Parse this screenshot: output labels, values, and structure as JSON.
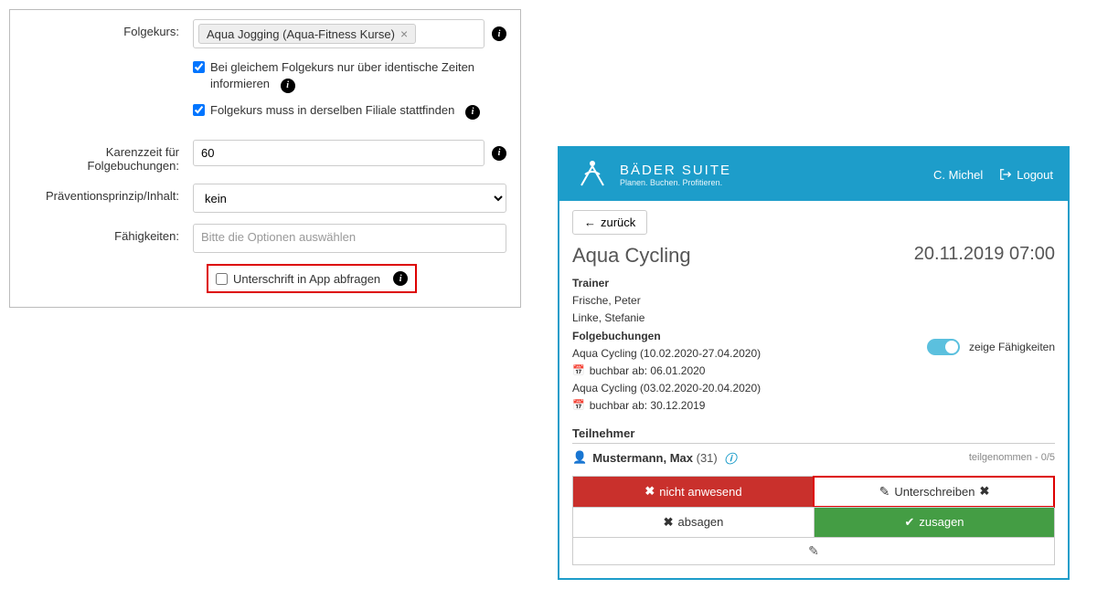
{
  "left": {
    "folgekurs_label": "Folgekurs:",
    "folgekurs_tag": "Aqua Jogging (Aqua-Fitness Kurse)",
    "cb_identical_times": "Bei gleichem Folgekurs nur über identische Zeiten informieren",
    "cb_same_branch": "Folgekurs muss in derselben Filiale stattfinden",
    "karenz_label": "Karenzzeit für Folgebuchungen:",
    "karenz_value": "60",
    "prinzip_label": "Präventionsprinzip/Inhalt:",
    "prinzip_value": "kein",
    "faehigkeiten_label": "Fähigkeiten:",
    "faehigkeiten_placeholder": "Bitte die Optionen auswählen",
    "cb_signature": "Unterschrift in App abfragen"
  },
  "right": {
    "brand": "BÄDER SUITE",
    "tagline": "Planen. Buchen. Profitieren.",
    "user": "C. Michel",
    "logout": "Logout",
    "back": "zurück",
    "course_title": "Aqua Cycling",
    "course_datetime": "20.11.2019 07:00",
    "trainer_label": "Trainer",
    "trainers": [
      "Frische, Peter",
      "Linke, Stefanie"
    ],
    "folgebuchungen_label": "Folgebuchungen",
    "followups": [
      {
        "title": "Aqua Cycling (10.02.2020-27.04.2020)",
        "bookable": "buchbar ab: 06.01.2020"
      },
      {
        "title": "Aqua Cycling (03.02.2020-20.04.2020)",
        "bookable": "buchbar ab: 30.12.2019"
      }
    ],
    "show_skills": "zeige Fähigkeiten",
    "teilnehmer_label": "Teilnehmer",
    "participant_name": "Mustermann, Max",
    "participant_age": "(31)",
    "participant_status": "teilgenommen - 0/5",
    "btn_not_present": "nicht anwesend",
    "btn_sign": "Unterschreiben",
    "btn_cancel": "absagen",
    "btn_confirm": "zusagen"
  }
}
